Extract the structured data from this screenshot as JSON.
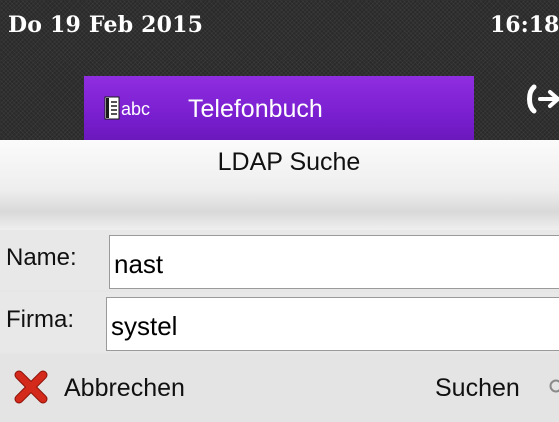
{
  "status_bar": {
    "date": "Do 19 Feb 2015",
    "time": "16:18"
  },
  "tabs": {
    "active": {
      "label": "Telefonbuch",
      "icon": "phonebook-icon",
      "icon_text": "abc"
    },
    "next_icon": "phone-icon"
  },
  "panel": {
    "title": "LDAP Suche"
  },
  "form": {
    "name": {
      "label": "Name:",
      "value": "nast"
    },
    "firma": {
      "label": "Firma:",
      "value": "systel"
    }
  },
  "softkeys": {
    "cancel": {
      "label": "Abbrechen",
      "icon": "close-icon"
    },
    "search": {
      "label": "Suchen",
      "icon": "search-icon"
    }
  },
  "colors": {
    "accent": "#7a1fd0",
    "status_bar_bg": "#2a2a2a",
    "cancel_icon": "#d42a1c"
  }
}
